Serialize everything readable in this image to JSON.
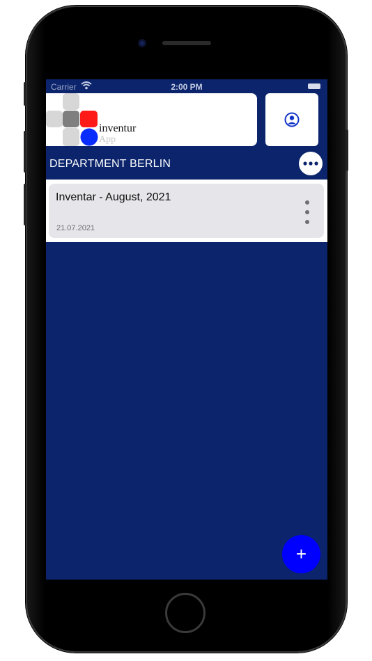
{
  "status_bar": {
    "carrier": "Carrier",
    "time": "2:00 PM"
  },
  "header": {
    "logo_title": "inventur",
    "logo_subtitle": "App",
    "profile_icon": "user-circle-icon"
  },
  "section": {
    "title": "DEPARTMENT BERLIN",
    "more_icon": "more-horizontal-icon"
  },
  "inventories": [
    {
      "title": "Inventar - August, 2021",
      "date": "21.07.2021",
      "menu_icon": "more-vertical-icon"
    }
  ],
  "fab": {
    "label": "+"
  },
  "colors": {
    "background": "#0b246b",
    "accent": "#0000ff",
    "card": "#e5e5ea",
    "logo_red": "#ff1a1a",
    "logo_blue": "#0a2dff"
  }
}
